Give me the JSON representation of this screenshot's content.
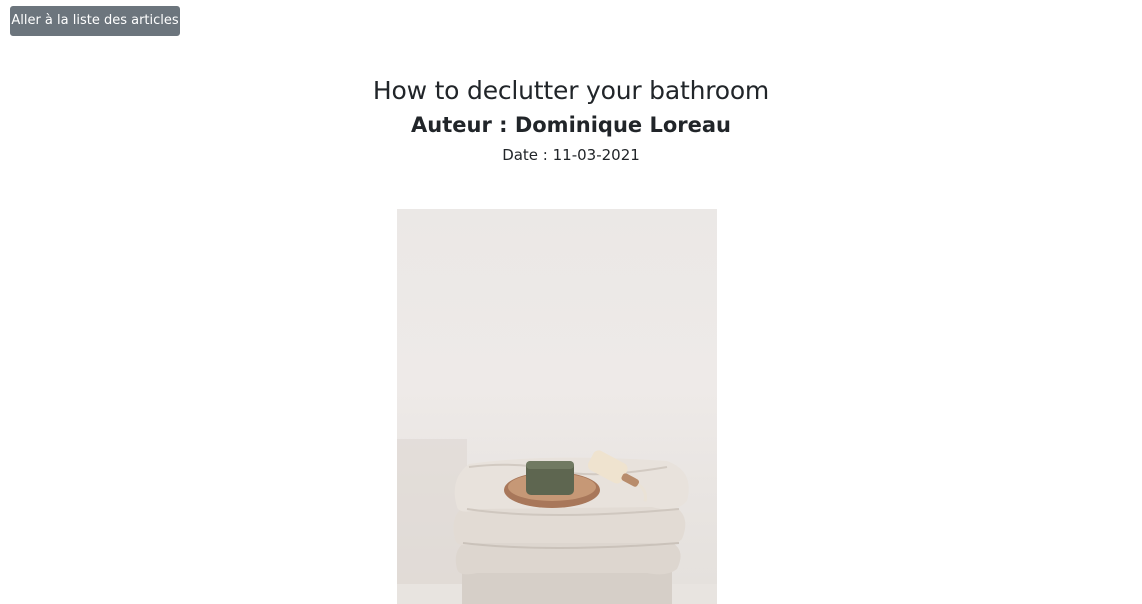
{
  "nav": {
    "back_label": "Aller à la liste des articles"
  },
  "article": {
    "title": "How to declutter your bathroom",
    "author": "Auteur : Dominique Loreau",
    "date": "Date : 11-03-2021",
    "image_icon": "photo-towels-soap"
  },
  "colors": {
    "button_bg": "#6c757d",
    "button_text": "#ffffff",
    "text": "#212529",
    "background": "#ffffff"
  }
}
